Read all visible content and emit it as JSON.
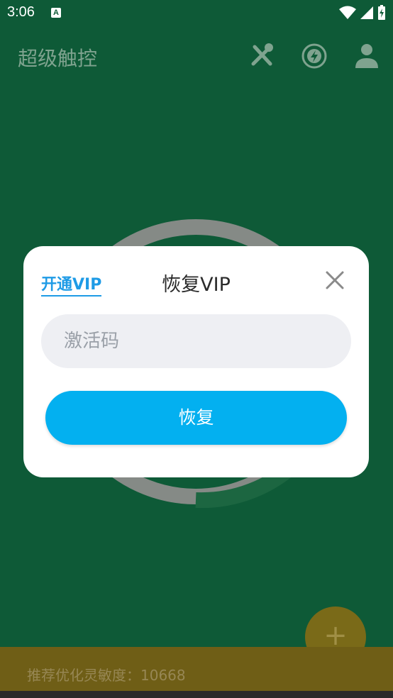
{
  "status_bar": {
    "time": "3:06",
    "notification_letter": "A"
  },
  "app_bar": {
    "title": "超级触控",
    "actions": [
      "wrench-screwdriver-icon",
      "boost-icon",
      "account-icon"
    ]
  },
  "fab": {
    "label": "+"
  },
  "bottom_bar": {
    "text": "推荐优化灵敏度：10668"
  },
  "dialog": {
    "tab_open_vip": "开通VIP",
    "title": "恢复VIP",
    "close_icon": "close-icon",
    "input": {
      "placeholder": "激活码",
      "value": ""
    },
    "restore_button": "恢复"
  },
  "colors": {
    "background": "#0e5a37",
    "accent_blue": "#03b0f0",
    "tab_blue": "#1e9be6",
    "input_bg": "#eeeff3"
  }
}
